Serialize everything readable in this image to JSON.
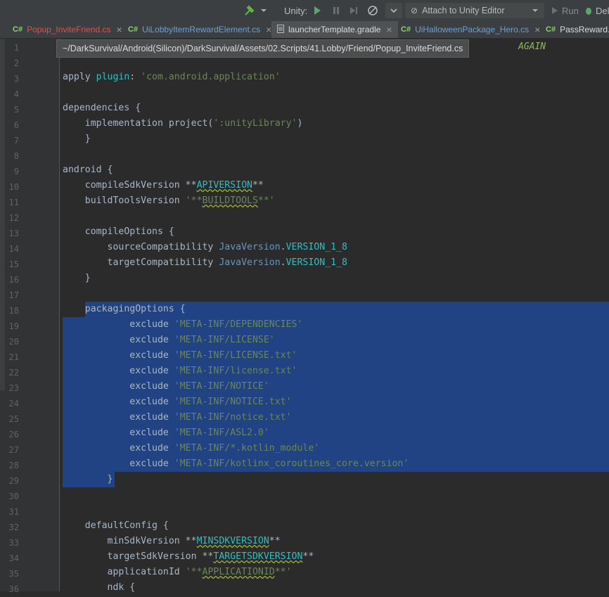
{
  "toolbar": {
    "unity_label": "Unity:",
    "attach_label": "Attach to Unity Editor",
    "run_label": "Run",
    "debug_label": "Del"
  },
  "tabs": [
    {
      "label": "Popup_InviteFriend.cs",
      "icon": "csharp-icon",
      "color": "#d9534f"
    },
    {
      "label": "UiLobbyItemRewardElement.cs",
      "icon": "csharp-icon"
    },
    {
      "label": "launcherTemplate.gradle",
      "icon": "file-icon",
      "active": true
    },
    {
      "label": "UiHalloweenPackage_Hero.cs",
      "icon": "csharp-icon"
    },
    {
      "label": "PassReward.c",
      "icon": "csharp-icon"
    }
  ],
  "tooltip": {
    "path": "~/DarkSurvival/Android(Silicon)/DarkSurvival/Assets/02.Scripts/41.Lobby/Friend/Popup_InviteFriend.cs",
    "tail": "AGAIN"
  },
  "code": {
    "first_line": 1,
    "lines": [
      "",
      "",
      "apply plugin: 'com.android.application'",
      "",
      "dependencies {",
      "    implementation project(':unityLibrary')",
      "    }",
      "",
      "android {",
      "    compileSdkVersion **APIVERSION**",
      "    buildToolsVersion '**BUILDTOOLS**'",
      "",
      "    compileOptions {",
      "        sourceCompatibility JavaVersion.VERSION_1_8",
      "        targetCompatibility JavaVersion.VERSION_1_8",
      "    }",
      "",
      "    packagingOptions {",
      "            exclude 'META-INF/DEPENDENCIES'",
      "            exclude 'META-INF/LICENSE'",
      "            exclude 'META-INF/LICENSE.txt'",
      "            exclude 'META-INF/license.txt'",
      "            exclude 'META-INF/NOTICE'",
      "            exclude 'META-INF/NOTICE.txt'",
      "            exclude 'META-INF/notice.txt'",
      "            exclude 'META-INF/ASL2.0'",
      "            exclude 'META-INF/*.kotlin_module'",
      "            exclude 'META-INF/kotlinx_coroutines_core.version'",
      "        }",
      "",
      "",
      "    defaultConfig {",
      "        minSdkVersion **MINSDKVERSION**",
      "        targetSdkVersion **TARGETSDKVERSION**",
      "        applicationId '**APPLICATIONID**'",
      "        ndk {"
    ]
  },
  "colors": {
    "background": "#2b2b2b",
    "selection": "#214283",
    "string": "#6a8759",
    "keyword": "#cc7832"
  }
}
